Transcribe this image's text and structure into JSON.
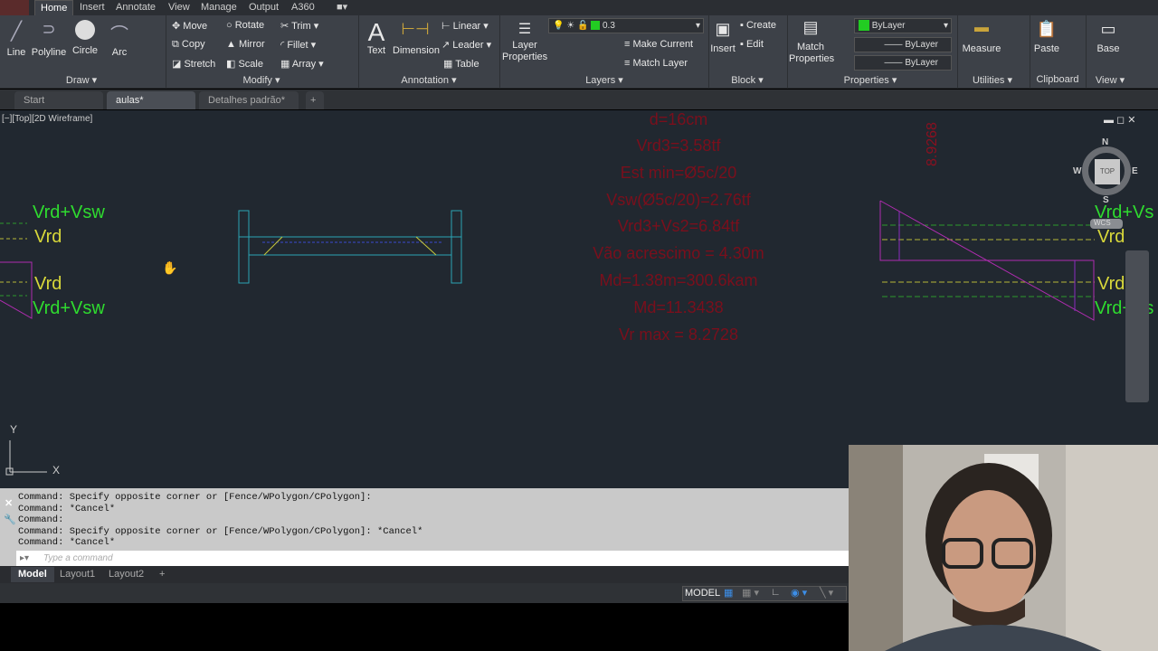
{
  "ribbon_tabs": [
    "Home",
    "Insert",
    "Annotate",
    "View",
    "Manage",
    "Output",
    "A360"
  ],
  "draw": {
    "line": "Line",
    "polyline": "Polyline",
    "circle": "Circle",
    "arc": "Arc",
    "panel": "Draw"
  },
  "modify": {
    "move": "Move",
    "rotate": "Rotate",
    "trim": "Trim",
    "copy": "Copy",
    "mirror": "Mirror",
    "fillet": "Fillet",
    "stretch": "Stretch",
    "scale": "Scale",
    "array": "Array",
    "panel": "Modify"
  },
  "annotation": {
    "text": "Text",
    "dimension": "Dimension",
    "linear": "Linear",
    "leader": "Leader",
    "table": "Table",
    "panel": "Annotation"
  },
  "layers": {
    "layer_properties": "Layer Properties",
    "current_layer": "0.3",
    "make_current": "Make Current",
    "match_layer": "Match Layer",
    "panel": "Layers",
    "layer_color": "#22cc22"
  },
  "block": {
    "insert": "Insert",
    "create": "Create",
    "edit": "Edit",
    "panel": "Block"
  },
  "properties": {
    "match": "Match Properties",
    "color": "ByLayer",
    "linetype": "ByLayer",
    "lineweight": "ByLayer",
    "panel": "Properties"
  },
  "utilities": {
    "measure": "Measure",
    "panel": "Utilities"
  },
  "clipboard": {
    "paste": "Paste",
    "panel": "Clipboard"
  },
  "view": {
    "base": "Base",
    "panel": "View"
  },
  "file_tabs": [
    "Start",
    "aulas*",
    "Detalhes padrão*"
  ],
  "viewport_label": "[−][Top][2D Wireframe]",
  "viewcube": {
    "top": "TOP",
    "n": "N",
    "s": "S",
    "e": "E",
    "w": "W",
    "wcs": "WCS"
  },
  "drawing": {
    "left_labels": [
      "Vrd+Vsw",
      "Vrd",
      "Vrd",
      "Vrd+Vsw"
    ],
    "right_labels": [
      "Vrd+Vs",
      "Vrd",
      "Vrd",
      "Vrd+Vs"
    ],
    "red_notes": [
      "d=16cm",
      "Vrd3=3.58tf",
      "Est min=Ø5c/20",
      "Vsw(Ø5c/20)=2.76tf",
      "Vrd3+Vs2=6.84tf",
      "Vão acrescimo = 4.30m",
      "Md=1.38m=300.6kam",
      "Md=11.3438",
      "Vr max = 8.2728"
    ],
    "vertical_note": "8.9268",
    "axis_x": "X",
    "axis_y": "Y"
  },
  "command_history": [
    "Command: Specify opposite corner or [Fence/WPolygon/CPolygon]:",
    "Command: *Cancel*",
    "Command:",
    "Command: Specify opposite corner or [Fence/WPolygon/CPolygon]: *Cancel*",
    "Command: *Cancel*"
  ],
  "command_placeholder": "Type a command",
  "layout_tabs": [
    "Model",
    "Layout1",
    "Layout2"
  ],
  "status": {
    "model": "MODEL"
  }
}
